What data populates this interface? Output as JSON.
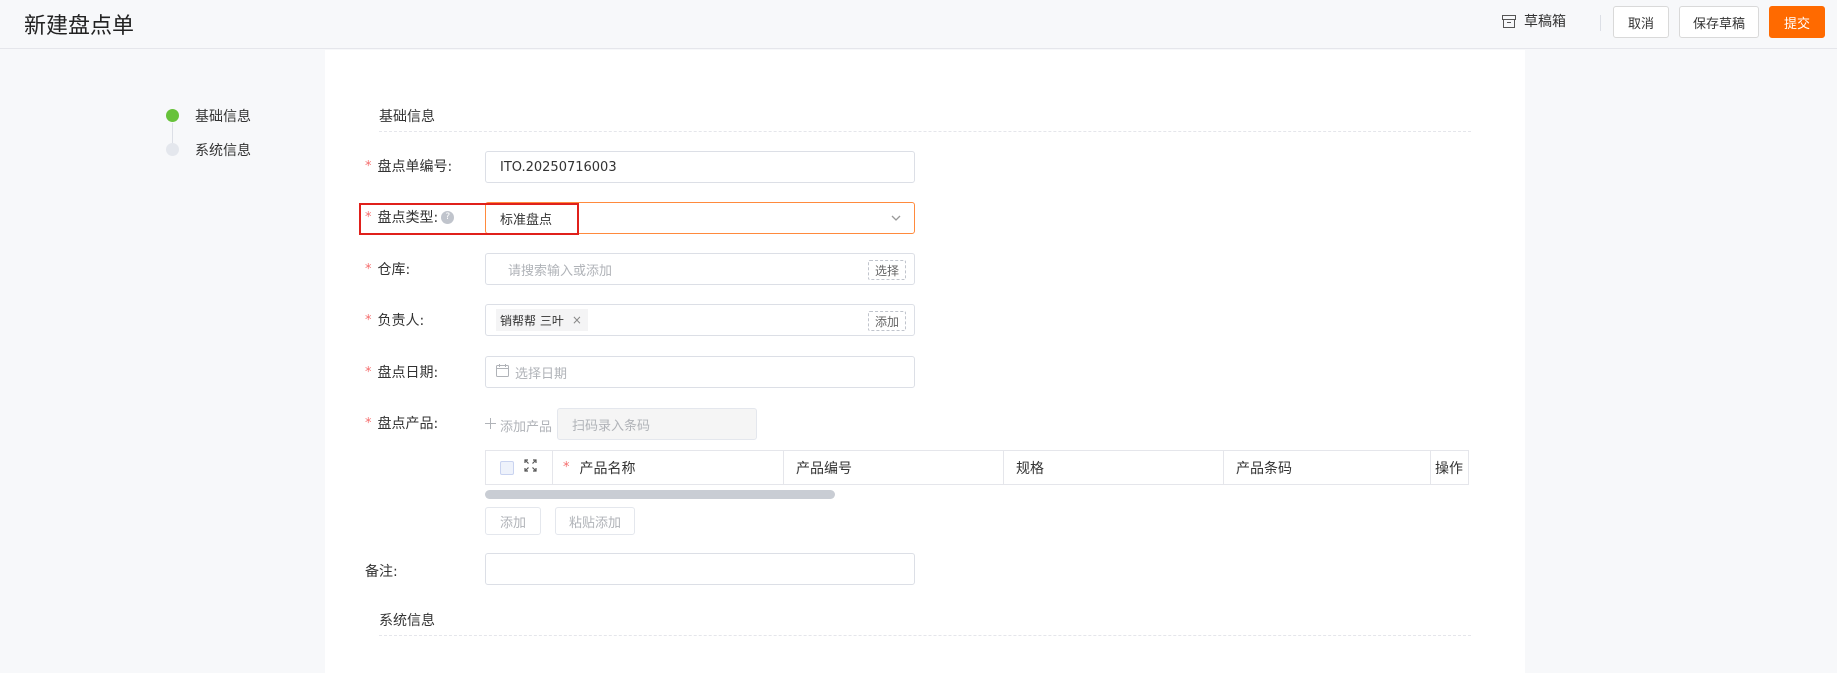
{
  "header": {
    "title": "新建盘点单",
    "drafts_label": "草稿箱",
    "cancel_label": "取消",
    "save_draft_label": "保存草稿",
    "submit_label": "提交"
  },
  "steps": [
    {
      "label": "基础信息",
      "status": "active"
    },
    {
      "label": "系统信息",
      "status": "pending"
    }
  ],
  "form": {
    "section_basic": "基础信息",
    "section_system": "系统信息",
    "required_mark": "*",
    "help_mark": "?",
    "fields": {
      "number": {
        "label": "盘点单编号:",
        "value": "ITO.20250716003"
      },
      "type": {
        "label": "盘点类型:",
        "value": "标准盘点"
      },
      "warehouse": {
        "label": "仓库:",
        "placeholder": "请搜索输入或添加",
        "action": "选择"
      },
      "owner": {
        "label": "负责人:",
        "tag": "销帮帮 三叶",
        "tag_close": "×",
        "action": "添加"
      },
      "date": {
        "label": "盘点日期:",
        "placeholder": "选择日期"
      },
      "products": {
        "label": "盘点产品:",
        "add_label": "添加产品",
        "scan_placeholder": "扫码录入条码"
      },
      "remark": {
        "label": "备注:",
        "value": ""
      }
    }
  },
  "product_table": {
    "columns": [
      "产品名称",
      "产品编号",
      "规格",
      "产品条码",
      "操作"
    ],
    "required_column": "产品名称",
    "add_button": "添加",
    "paste_button": "粘贴添加"
  },
  "colors": {
    "accent": "#ff6a00",
    "step_active": "#67c23a",
    "highlight": "#e0201b"
  },
  "icons": [
    "archive-icon",
    "help-icon",
    "chevron-down-icon",
    "close-icon",
    "calendar-icon",
    "plus-icon",
    "expand-icon",
    "checkbox-icon"
  ]
}
